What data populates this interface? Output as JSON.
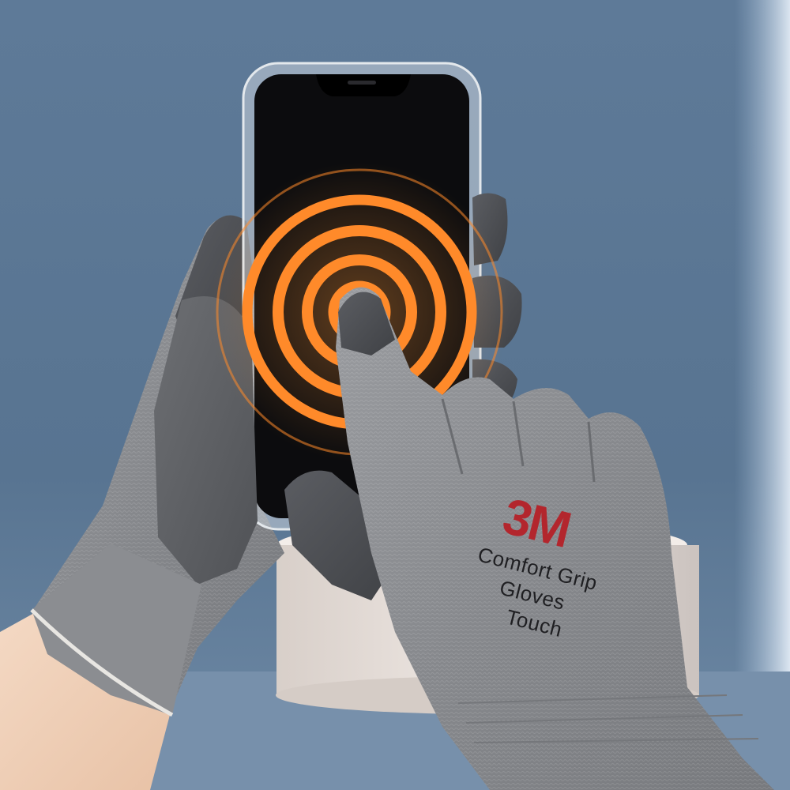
{
  "glove_print": {
    "brand": "3M",
    "line1": "Comfort Grip",
    "line2": "Gloves",
    "line3": "Touch"
  },
  "colors": {
    "background": "#5b7796",
    "ripple": "#ff8a2a",
    "brand_red": "#b3262d",
    "glove_knit": "#8a8c90",
    "glove_coating": "#55575c"
  }
}
